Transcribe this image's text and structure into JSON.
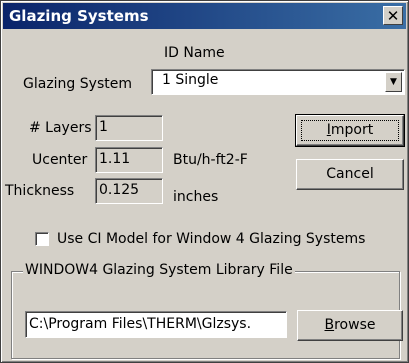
{
  "window": {
    "title": "Glazing Systems",
    "close_glyph": "✕"
  },
  "glazing": {
    "id_name_header": "ID Name",
    "label": "Glazing System",
    "selected": "1 Single"
  },
  "layers": {
    "label": "# Layers",
    "value": "1"
  },
  "ucenter": {
    "label": "Ucenter",
    "value": "1.11",
    "unit": "Btu/h-ft2-F"
  },
  "thickness": {
    "label": "Thickness",
    "value": "0.125",
    "unit": "inches"
  },
  "buttons": {
    "import_u": "I",
    "import_rest": "mport",
    "cancel": "Cancel",
    "browse_u": "B",
    "browse_rest": "rowse"
  },
  "cl_model": {
    "label": "Use CI Model for Window 4 Glazing Systems",
    "checked": false
  },
  "library": {
    "group_label": "WINDOW4 Glazing System Library File",
    "path": "C:\\Program Files\\THERM\\Glzsys."
  }
}
